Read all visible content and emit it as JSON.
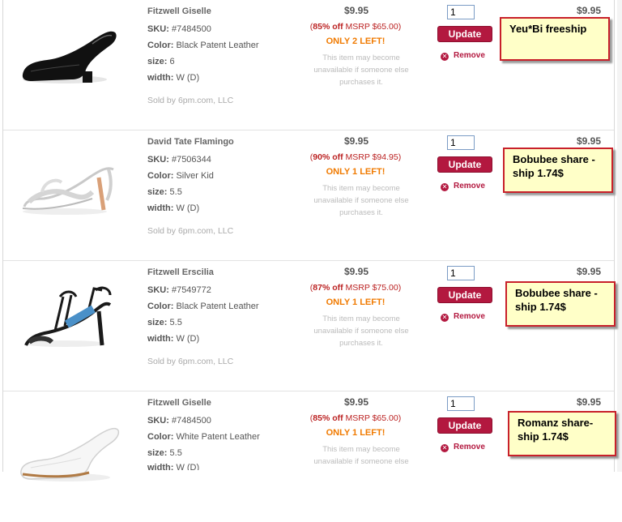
{
  "items": [
    {
      "name": "Fitzwell Giselle",
      "sku_label": "SKU:",
      "sku": "#7484500",
      "color_label": "Color:",
      "color": "Black Patent Leather",
      "size_label": "size:",
      "size": "6",
      "width_label": "width:",
      "width": "W (D)",
      "sold_by": "Sold by 6pm.com, LLC",
      "price": "$9.95",
      "msrp_pct": "85% off",
      "msrp_text": "MSRP $65.00",
      "stock": "ONLY 2 LEFT!",
      "note1": "This item may become",
      "note2": "unavailable if someone else",
      "note3": "purchases it.",
      "qty": "1",
      "update_label": "Update",
      "remove_label": "Remove",
      "total": "$9.95",
      "annotation": "Yeu*Bi freeship"
    },
    {
      "name": "David Tate Flamingo",
      "sku_label": "SKU:",
      "sku": "#7506344",
      "color_label": "Color:",
      "color": "Silver Kid",
      "size_label": "size:",
      "size": "5.5",
      "width_label": "width:",
      "width": "W (D)",
      "sold_by": "Sold by 6pm.com, LLC",
      "price": "$9.95",
      "msrp_pct": "90% off",
      "msrp_text": "MSRP $94.95",
      "stock": "ONLY 1 LEFT!",
      "note1": "This item may become",
      "note2": "unavailable if someone else",
      "note3": "purchases it.",
      "qty": "1",
      "update_label": "Update",
      "remove_label": "Remove",
      "total": "$9.95",
      "annotation": "Bobubee share -ship 1.74$"
    },
    {
      "name": "Fitzwell Erscilia",
      "sku_label": "SKU:",
      "sku": "#7549772",
      "color_label": "Color:",
      "color": "Black Patent Leather",
      "size_label": "size:",
      "size": "5.5",
      "width_label": "width:",
      "width": "W (D)",
      "sold_by": "Sold by 6pm.com, LLC",
      "price": "$9.95",
      "msrp_pct": "87% off",
      "msrp_text": "MSRP $75.00",
      "stock": "ONLY 1 LEFT!",
      "note1": "This item may become",
      "note2": "unavailable if someone else",
      "note3": "purchases it.",
      "qty": "1",
      "update_label": "Update",
      "remove_label": "Remove",
      "total": "$9.95",
      "annotation": "Bobubee share -ship 1.74$"
    },
    {
      "name": "Fitzwell Giselle",
      "sku_label": "SKU:",
      "sku": "#7484500",
      "color_label": "Color:",
      "color": "White Patent Leather",
      "size_label": "size:",
      "size": "5.5",
      "width_label": "width:",
      "width": "W (D)",
      "sold_by": "",
      "price": "$9.95",
      "msrp_pct": "85% off",
      "msrp_text": "MSRP $65.00",
      "stock": "ONLY 1 LEFT!",
      "note1": "This item may become",
      "note2": "unavailable if someone else",
      "note3": "",
      "qty": "1",
      "update_label": "Update",
      "remove_label": "Remove",
      "total": "$9.95",
      "annotation": "Romanz share- ship 1.74$"
    }
  ],
  "colors": {
    "accent": "#b3183f",
    "stock": "#f07a00",
    "annotation_bg": "#ffffc8",
    "annotation_border": "#c8202a"
  },
  "icons": {
    "remove": "remove-x-icon"
  }
}
